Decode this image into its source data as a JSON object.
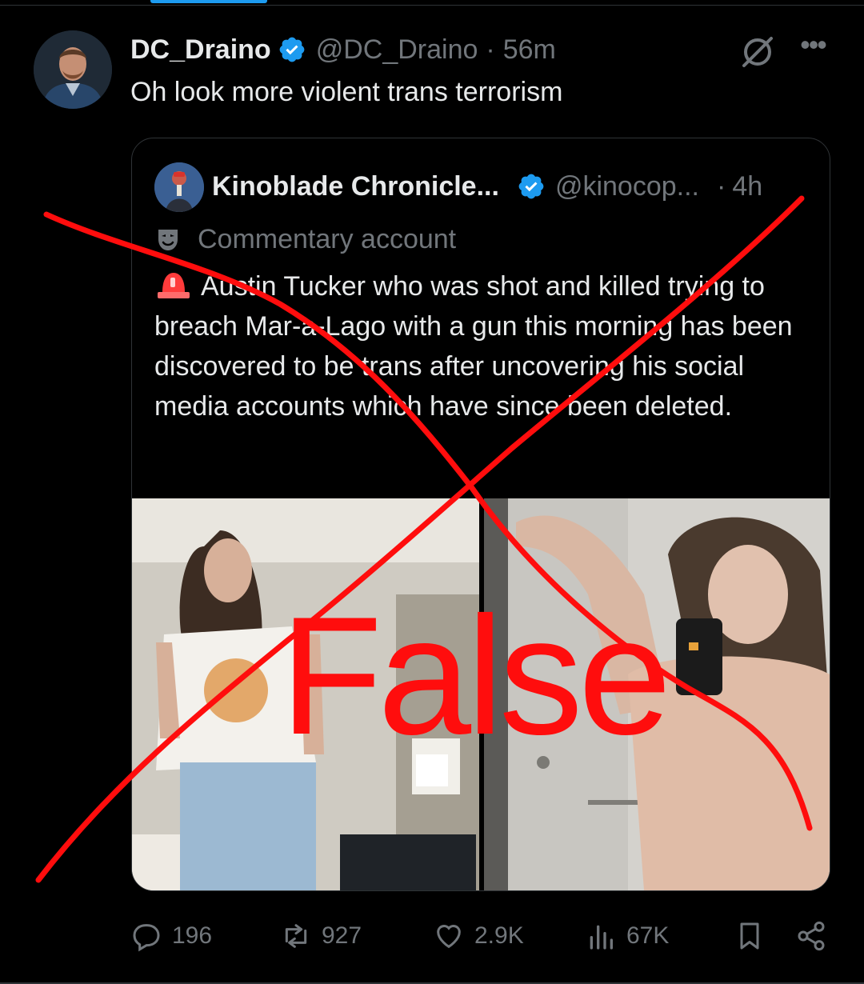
{
  "post": {
    "author_name": "DC_Draino",
    "author_handle": "@DC_Draino",
    "separator": "·",
    "time": "56m",
    "text": "Oh look more violent trans terrorism"
  },
  "quote": {
    "author_name": "Kinoblade Chronicle...",
    "author_handle": "@kinocop...",
    "separator": "·",
    "time": "4h",
    "label": "Commentary account",
    "text": "Austin Tucker who was shot and killed trying to breach Mar-a-Lago with a gun this morning has been discovered to be trans after uncovering his social media accounts which have since been deleted."
  },
  "overlay": {
    "stamp": "False"
  },
  "actions": {
    "replies": "196",
    "reposts": "927",
    "likes": "2.9K",
    "views": "67K"
  },
  "colors": {
    "background": "#000000",
    "text": "#e7e9ea",
    "muted": "#71767b",
    "verified": "#1d9bf0",
    "overlay_red": "#ff0d0d"
  },
  "icons": [
    "verified-badge-icon",
    "grok-icon",
    "more-icon",
    "commentary-mask-icon",
    "siren-icon",
    "reply-icon",
    "repost-icon",
    "like-icon",
    "views-icon",
    "bookmark-icon",
    "share-icon"
  ]
}
